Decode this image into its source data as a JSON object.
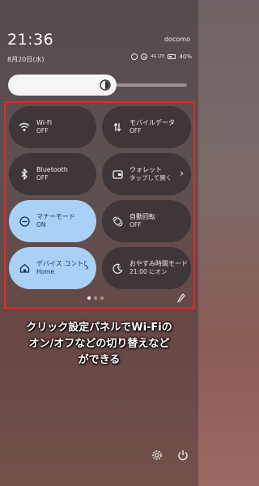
{
  "status_bar": {
    "time": "21:36",
    "carrier": "docomo",
    "date": "8月20日(水)",
    "icons": [
      "alarm-icon",
      "do-not-disturb-icon",
      "signal-icon",
      "battery-icon"
    ],
    "network_label": "4G LTE",
    "battery_text": "40%"
  },
  "brightness": {
    "level": 0.6,
    "icon": "brightness-icon"
  },
  "tiles": [
    {
      "label": "Wi-Fi",
      "state": "OFF",
      "icon": "wifi-icon",
      "on": false
    },
    {
      "label": "モバイルデータ",
      "state": "OFF",
      "icon": "mobile-data-icon",
      "on": false
    },
    {
      "label": "Bluetooth",
      "state": "OFF",
      "icon": "bluetooth-icon",
      "on": false
    },
    {
      "label": "ウォレット",
      "state": "タップして開く",
      "icon": "wallet-icon",
      "on": false
    },
    {
      "label": "マナーモード",
      "state": "ON",
      "icon": "silent-mode-icon",
      "on": true
    },
    {
      "label": "自動回転",
      "state": "OFF",
      "icon": "auto-rotate-icon",
      "on": false
    },
    {
      "label": "デバイス コントロール",
      "state": "Home",
      "icon": "home-icon",
      "on": true
    },
    {
      "label": "おやすみ時間モード",
      "state": "21:00 にオン",
      "icon": "bedtime-icon",
      "on": false
    }
  ],
  "pager": {
    "pages": 3,
    "current": 1
  },
  "caption": {
    "line1": "クリック設定パネルでWi-Fiの",
    "line2": "オン/オフなどの切り替えなど",
    "line3": "ができる"
  },
  "colors": {
    "tile_off": "#3e3638",
    "tile_on": "#a9d1f5",
    "highlight_border": "#e32828"
  },
  "bottom_icons": [
    "settings-icon",
    "power-icon"
  ]
}
